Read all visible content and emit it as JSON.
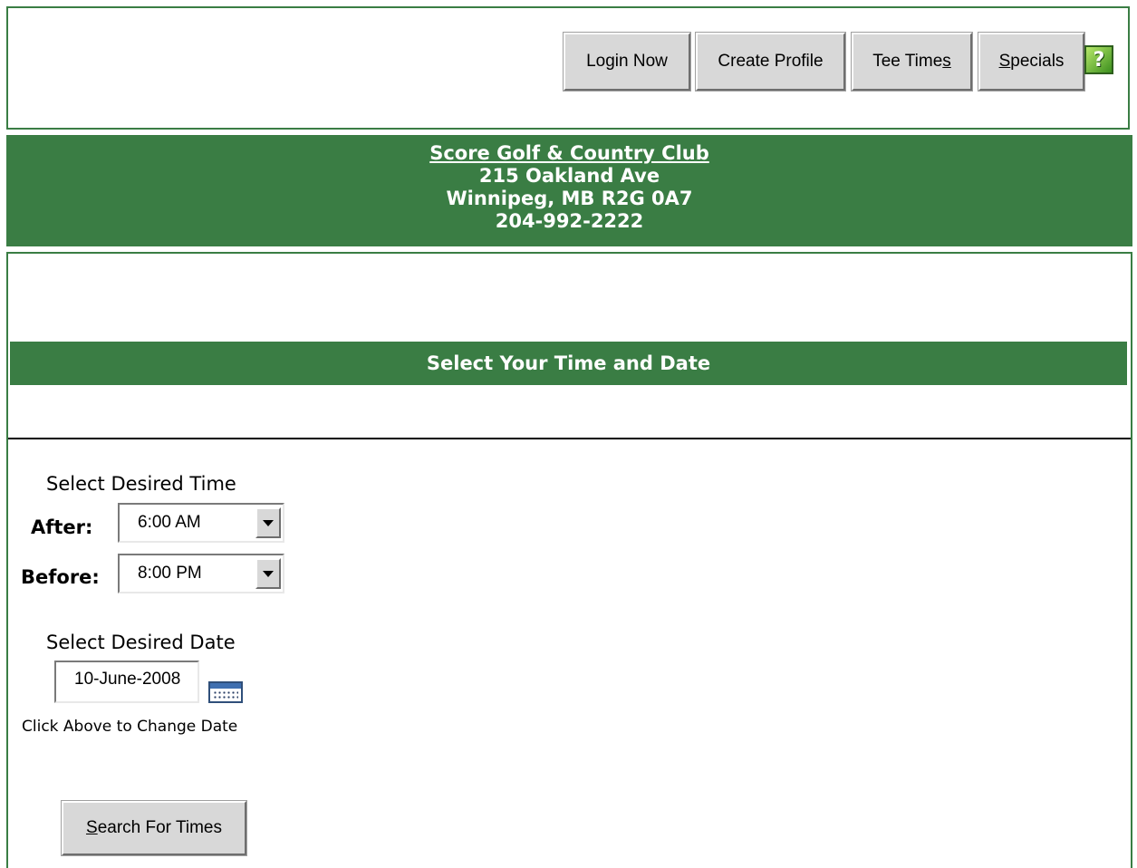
{
  "nav": {
    "login": "Login Now",
    "create_profile": "Create Profile",
    "tee_times_prefix": "Tee Time",
    "tee_times_key": "s",
    "specials_key": "S",
    "specials_rest": "pecials",
    "help_icon": "?"
  },
  "club": {
    "name": "Score Golf & Country Club",
    "address": "215 Oakland Ave",
    "city": "Winnipeg, MB R2G 0A7",
    "phone": "204-992-2222"
  },
  "section": {
    "title": "Select Your Time and Date"
  },
  "time": {
    "heading": "Select Desired Time",
    "after_label": "After:",
    "after_value": "6:00 AM",
    "before_label": "Before:",
    "before_value": "8:00 PM"
  },
  "date": {
    "heading": "Select Desired Date",
    "value": "10-June-2008",
    "hint": "Click Above to Change Date"
  },
  "search": {
    "key": "S",
    "rest": "earch For Times"
  },
  "colors": {
    "brand_green": "#3a7d44",
    "button_face": "#d8d8d8"
  }
}
